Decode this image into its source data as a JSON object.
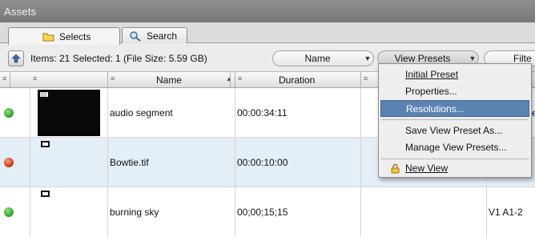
{
  "panel": {
    "title": "Assets"
  },
  "tabs": [
    {
      "label": "Selects",
      "icon": "folder-icon"
    },
    {
      "label": "Search",
      "icon": "magnifier-icon"
    }
  ],
  "toolbar": {
    "items_summary": "Items: 21 Selected: 1 (File Size: 5.59 GB)",
    "sort_value": "Name",
    "view_presets_label": "View Presets",
    "filter_label": "Filte"
  },
  "columns": [
    {
      "label": ""
    },
    {
      "label": ""
    },
    {
      "label": "Name"
    },
    {
      "label": "Duration"
    },
    {
      "label": ""
    },
    {
      "label": ""
    }
  ],
  "rows": [
    {
      "status": "green",
      "name": "audio segment",
      "duration": "00:00:34:11",
      "col6": "",
      "status_color": "#3aa832"
    },
    {
      "status": "red",
      "name": "Bowtie.tif",
      "duration": "00:00:10:00",
      "col6": "",
      "status_color": "#d2401e"
    },
    {
      "status": "green",
      "name": "burning sky",
      "duration": "00;00;15;15",
      "col6": "V1 A1-2",
      "status_color": "#3aa832"
    }
  ],
  "menu": {
    "items": [
      "Initial Preset",
      "Properties...",
      "Resolutions...",
      "Save View Preset As...",
      "Manage View Presets...",
      "New View"
    ],
    "selected": "Resolutions..."
  },
  "colors": {
    "menu_highlight": "#5c82b1",
    "selected_row": "#e3eef6"
  }
}
